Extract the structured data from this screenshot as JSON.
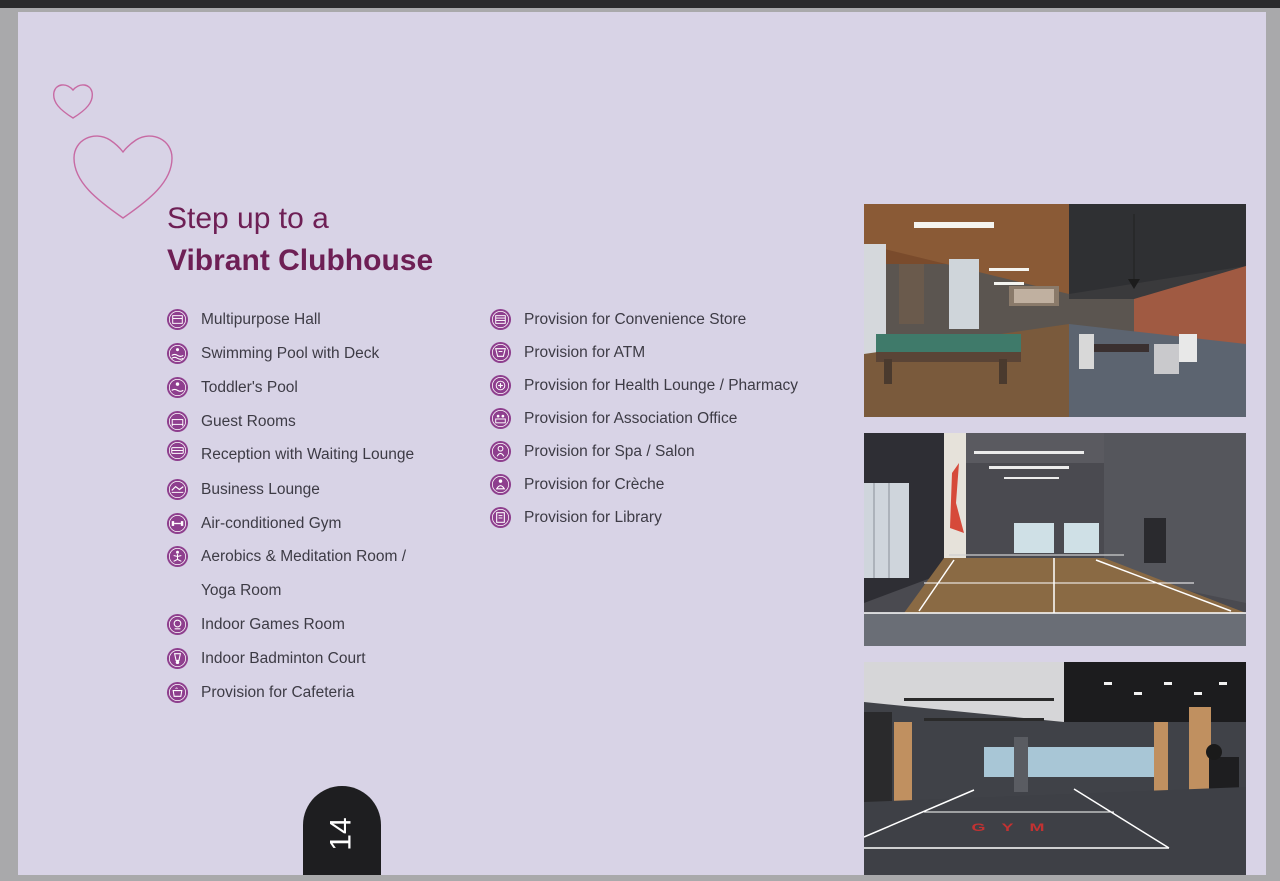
{
  "headline": {
    "line1": "Step up to a",
    "line2": "Vibrant Clubhouse"
  },
  "amenities_left": [
    {
      "label": "Multipurpose Hall",
      "icon": "hall-icon"
    },
    {
      "label": "Swimming Pool with Deck",
      "icon": "pool-icon"
    },
    {
      "label": "Toddler's Pool",
      "icon": "toddler-pool-icon"
    },
    {
      "label": "Guest Rooms",
      "icon": "bed-icon"
    },
    {
      "label": "Reception with Waiting Lounge",
      "icon": "sofa-icon"
    },
    {
      "label": "Business Lounge",
      "icon": "briefcase-icon"
    },
    {
      "label": "Air-conditioned Gym",
      "icon": "dumbbell-icon"
    },
    {
      "label": "Aerobics & Meditation Room /",
      "label2": "Yoga Room",
      "icon": "yoga-icon"
    },
    {
      "label": "Indoor Games Room",
      "icon": "games-icon"
    },
    {
      "label": "Indoor Badminton Court",
      "icon": "shuttlecock-icon"
    },
    {
      "label": "Provision for Cafeteria",
      "icon": "cup-icon"
    }
  ],
  "amenities_right": [
    {
      "label": "Provision for Convenience Store",
      "icon": "store-icon"
    },
    {
      "label": "Provision for ATM",
      "icon": "atm-icon"
    },
    {
      "label": "Provision for Health Lounge / Pharmacy",
      "icon": "health-icon"
    },
    {
      "label": "Provision for Association Office",
      "icon": "office-icon"
    },
    {
      "label": "Provision for Spa / Salon",
      "icon": "spa-icon"
    },
    {
      "label": "Provision for Crèche",
      "icon": "creche-icon"
    },
    {
      "label": "Provision for Library",
      "icon": "book-icon"
    }
  ],
  "photos": [
    "clubhouse-lounge-photo",
    "badminton-court-photo",
    "gym-photo"
  ],
  "gym_floor_text": "GYM",
  "page_number": "14",
  "colors": {
    "page_bg": "#d8d3e6",
    "headline": "#6e1f55",
    "icon": "#8e3f8e",
    "heart": "#c76aa3",
    "page_tab": "#1e1e20"
  }
}
